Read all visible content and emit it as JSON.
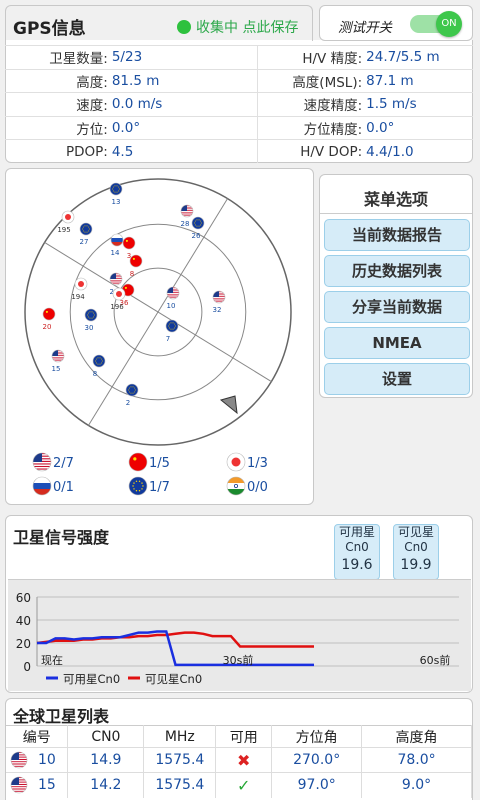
{
  "gps_info": {
    "title": "GPS信息",
    "status": "收集中 点此保存",
    "rows": [
      {
        "l1": "卫星数量:",
        "v1": "5/23",
        "l2": "H/V 精度:",
        "v2": "24.7/5.5 m"
      },
      {
        "l1": "高度:",
        "v1": "81.5 m",
        "l2": "高度(MSL):",
        "v2": "87.1 m"
      },
      {
        "l1": "速度:",
        "v1": "0.0 m/s",
        "l2": "速度精度:",
        "v2": "1.5 m/s"
      },
      {
        "l1": "方位:",
        "v1": "0.0°",
        "l2": "方位精度:",
        "v2": "0.0°"
      },
      {
        "l1": "PDOP:",
        "v1": "4.5",
        "l2": "H/V DOP:",
        "v2": "4.4/1.0"
      }
    ]
  },
  "test_switch": {
    "label": "测试开关",
    "state": "ON"
  },
  "menu": {
    "title": "菜单选项",
    "items": [
      "当前数据报告",
      "历史数据列表",
      "分享当前数据",
      "NMEA",
      "设置"
    ]
  },
  "sky": {
    "satellites": [
      {
        "id": "13",
        "flag": "eu"
      },
      {
        "id": "195",
        "flag": "jp"
      },
      {
        "id": "27",
        "flag": "eu"
      },
      {
        "id": "14",
        "flag": "ru"
      },
      {
        "id": "3",
        "flag": "cn"
      },
      {
        "id": "28",
        "flag": "us"
      },
      {
        "id": "26",
        "flag": "eu"
      },
      {
        "id": "8",
        "flag": "cn"
      },
      {
        "id": "23",
        "flag": "us"
      },
      {
        "id": "194",
        "flag": "jp"
      },
      {
        "id": "36",
        "flag": "cn"
      },
      {
        "id": "196",
        "flag": "jp"
      },
      {
        "id": "10",
        "flag": "us"
      },
      {
        "id": "32",
        "flag": "us"
      },
      {
        "id": "20",
        "flag": "cn"
      },
      {
        "id": "30",
        "flag": "eu"
      },
      {
        "id": "7",
        "flag": "eu"
      },
      {
        "id": "15",
        "flag": "us"
      },
      {
        "id": "8",
        "flag": "eu"
      },
      {
        "id": "2",
        "flag": "eu"
      }
    ],
    "summary": [
      {
        "flag": "us",
        "value": "2/7"
      },
      {
        "flag": "cn",
        "value": "1/5"
      },
      {
        "flag": "jp",
        "value": "1/3"
      },
      {
        "flag": "ru",
        "value": "0/1"
      },
      {
        "flag": "eu",
        "value": "1/7"
      },
      {
        "flag": "in",
        "value": "0/0"
      }
    ]
  },
  "signal": {
    "title": "卫星信号强度",
    "usable_label": "可用星",
    "visible_label": "可见星",
    "cn0_label": "Cn0",
    "usable_value": "19.6",
    "visible_value": "19.9",
    "x_labels": [
      "现在",
      "30s前",
      "60s前"
    ],
    "legend_usable": "可用星Cn0",
    "legend_visible": "可见星Cn0"
  },
  "chart_data": {
    "type": "line",
    "ylim": [
      0,
      60
    ],
    "y_ticks": [
      0,
      20,
      40,
      60
    ],
    "x_labels": [
      "现在",
      "30s前",
      "60s前"
    ],
    "series": [
      {
        "name": "可用星Cn0",
        "color": "#1a2fe0",
        "values": [
          20,
          20,
          24,
          24,
          23,
          24,
          24,
          25,
          25,
          25,
          27,
          29,
          29,
          30,
          30,
          1,
          1,
          1,
          1,
          1,
          1,
          1,
          1,
          1,
          1,
          1,
          1,
          1,
          1,
          1,
          1
        ]
      },
      {
        "name": "可见星Cn0",
        "color": "#e01010",
        "values": [
          20,
          21,
          22,
          22,
          22,
          23,
          23,
          24,
          24,
          25,
          25,
          26,
          26,
          27,
          27,
          28,
          29,
          29,
          28,
          26,
          26,
          26,
          17,
          17,
          17,
          17,
          17,
          17,
          17,
          17,
          17
        ]
      }
    ]
  },
  "sat_list": {
    "title": "全球卫星列表",
    "headers": [
      "编号",
      "CN0",
      "MHz",
      "可用",
      "方位角",
      "高度角"
    ],
    "rows": [
      {
        "flag": "us",
        "id": "10",
        "cn0": "14.9",
        "mhz": "1575.4",
        "usable": false,
        "azimuth": "270.0°",
        "elevation": "78.0°"
      },
      {
        "flag": "us",
        "id": "15",
        "cn0": "14.2",
        "mhz": "1575.4",
        "usable": true,
        "azimuth": "97.0°",
        "elevation": "9.0°"
      }
    ]
  },
  "colors": {
    "accent_blue": "#1a4ea0",
    "button_bg": "#d6ecf8",
    "status_green": "#2ec13e"
  }
}
